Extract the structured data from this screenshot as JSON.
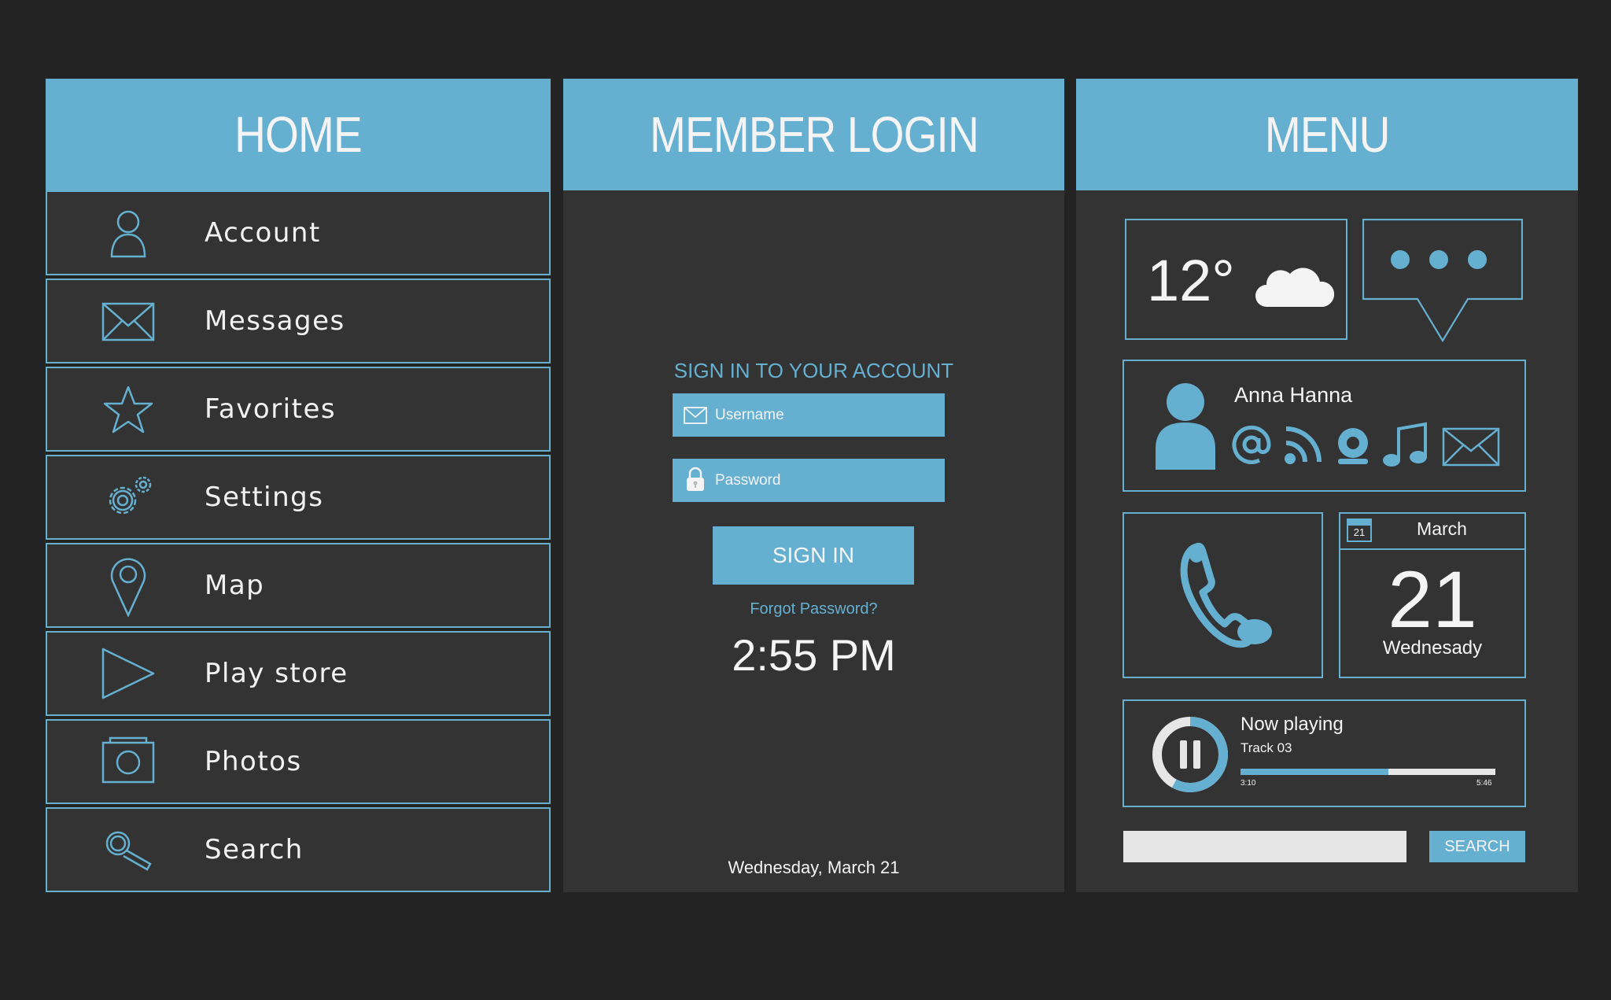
{
  "home": {
    "title": "HOME",
    "items": [
      {
        "label": "Account",
        "icon": "user-icon"
      },
      {
        "label": "Messages",
        "icon": "envelope-icon"
      },
      {
        "label": "Favorites",
        "icon": "star-icon"
      },
      {
        "label": "Settings",
        "icon": "gear-icon"
      },
      {
        "label": "Map",
        "icon": "map-pin-icon"
      },
      {
        "label": "Play store",
        "icon": "play-icon"
      },
      {
        "label": "Photos",
        "icon": "camera-icon"
      },
      {
        "label": "Search",
        "icon": "search-icon"
      }
    ]
  },
  "login": {
    "title": "MEMBER LOGIN",
    "subtitle": "SIGN IN TO YOUR ACCOUNT",
    "username_placeholder": "Username",
    "password_placeholder": "Password",
    "signin_label": "SIGN IN",
    "forgot_label": "Forgot Password?",
    "time": "2:55 PM",
    "date": "Wednesday, March 21"
  },
  "menu": {
    "title": "MENU",
    "weather": {
      "temp": "12°"
    },
    "contact": {
      "name": "Anna Hanna"
    },
    "calendar": {
      "badge": "21",
      "month": "March",
      "day": "21",
      "weekday": "Wednesady"
    },
    "player": {
      "title": "Now playing",
      "track": "Track 03",
      "elapsed": "3:10",
      "total": "5:46",
      "progress": 0.58
    },
    "search_label": "SEARCH"
  },
  "colors": {
    "accent": "#65b0d1",
    "panel": "#333333",
    "background": "#232323",
    "text": "#f4f4f4"
  }
}
